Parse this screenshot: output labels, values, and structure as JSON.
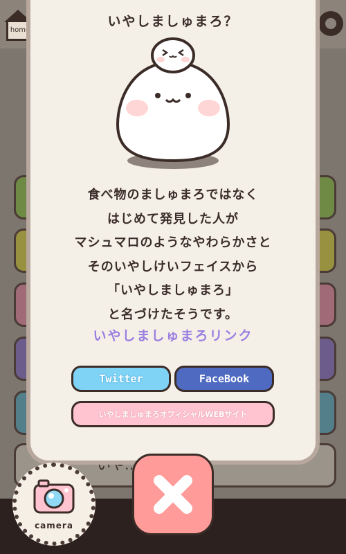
{
  "modal": {
    "title": "いやしましゅまろ？",
    "description_lines": [
      "食べ物のましゅまろではなく",
      "はじめて発見した人が",
      "マシュマロのようなやわらかさと",
      "そのいやしけいフェイスから",
      "「いやしましゅまろ」",
      "と名づけたそうです。"
    ],
    "link_label": "いやしましゅまろリンク",
    "buttons": {
      "twitter": "Twitter",
      "facebook": "FaceBook",
      "official": "いやしましゅまろオフィシャルWEBサイト"
    }
  },
  "background": {
    "home_label": "home",
    "partial_button_text": "いや…まろ？"
  },
  "camera": {
    "label": "camera"
  },
  "icons": {
    "close": "close-x-icon",
    "camera": "camera-icon",
    "settings": "gear-icon",
    "home": "home-icon"
  },
  "colors": {
    "twitter": "#7fd3f5",
    "facebook": "#4e6bc1",
    "official": "#ffc4d0",
    "close": "#ff9c9a",
    "link": "#9a7ee0",
    "text": "#3b2c28"
  }
}
